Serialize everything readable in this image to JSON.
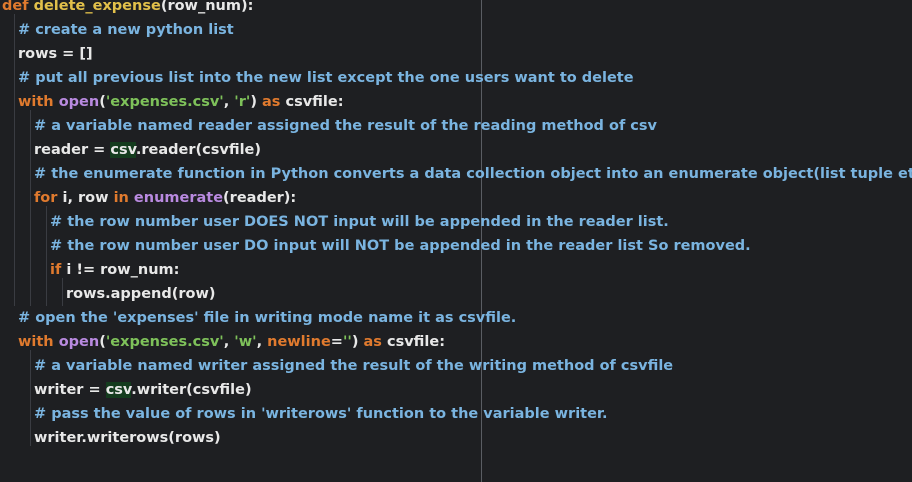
{
  "code": {
    "l1": {
      "kw": "def",
      "fn": " delete_expense",
      "rest": "(row_num):"
    },
    "l2": {
      "cm": "# create a new python list"
    },
    "l3": {
      "tx": "rows = []"
    },
    "l4": {
      "cm": "# put all previous list into the new list except the one users want to delete"
    },
    "l5": {
      "kw": "with",
      "sp": " ",
      "bi": "open",
      "p1": "(",
      "s1": "'expenses.csv'",
      "c1": ", ",
      "s2": "'r'",
      "p2": ") ",
      "kw2": "as",
      "rest": " csvfile:"
    },
    "l6": {
      "cm": "# a variable named reader assigned the result of the reading method of csv"
    },
    "l7": {
      "pre": "reader = ",
      "hl": "csv",
      "rest": ".reader(csvfile)"
    },
    "l8": {
      "cm": "# the enumerate function in Python converts a data collection object into an enumerate object(list tuple etc)."
    },
    "l9": {
      "kw": "for",
      "t1": " i, row ",
      "kw2": "in",
      "sp": " ",
      "bi": "enumerate",
      "rest": "(reader):"
    },
    "l10": {
      "cm": "# the row number user DOES NOT input will be appended in the reader list."
    },
    "l11": {
      "cm": "# the row number user DO input will NOT be appended in the reader list So removed."
    },
    "l12": {
      "kw": "if",
      "rest": " i != row_num:"
    },
    "l13": {
      "tx": "rows.append(row)"
    },
    "l14": {
      "cm": "# open the 'expenses' file in writing mode name it as csvfile."
    },
    "l15": {
      "kw": "with",
      "sp": " ",
      "bi": "open",
      "p1": "(",
      "s1": "'expenses.csv'",
      "c1": ", ",
      "s2": "'w'",
      "c2": ", ",
      "kw3": "newline",
      "eq": "=",
      "s3": "''",
      "p2": ") ",
      "kw2": "as",
      "rest": " csvfile:"
    },
    "l16": {
      "cm": "# a variable named writer assigned the result of the writing method of csvfile"
    },
    "l17": {
      "pre": "writer = ",
      "hl": "csv",
      "rest": ".writer(csvfile)"
    },
    "l18": {
      "cm": "# pass the value of rows in 'writerows' function to the variable writer."
    },
    "l19": {
      "tx": "writer.writerows(rows)"
    }
  },
  "colors": {
    "background": "#1e1f22",
    "keyword": "#e07a2e",
    "function": "#e2c04a",
    "builtin": "#b98ae0",
    "string": "#7ec15a",
    "comment": "#7ab4e0",
    "text": "#e8e8e8"
  }
}
